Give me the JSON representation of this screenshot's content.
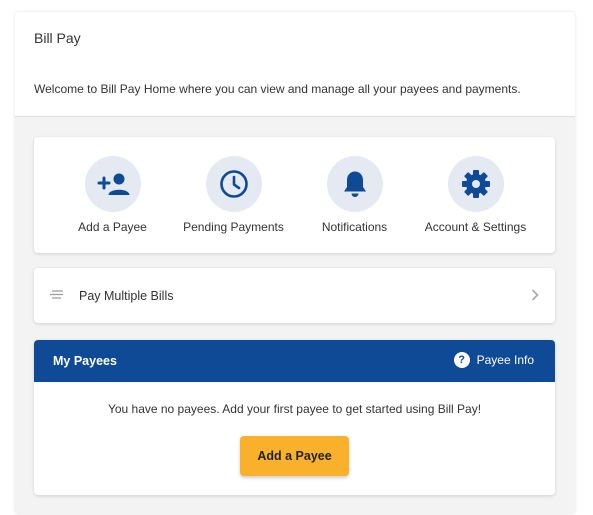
{
  "header": {
    "title": "Bill Pay",
    "welcome": "Welcome to Bill Pay Home where you can view and manage all your payees and payments."
  },
  "quick_actions": [
    {
      "label": "Add a Payee",
      "icon": "add-person-icon"
    },
    {
      "label": "Pending Payments",
      "icon": "clock-icon"
    },
    {
      "label": "Notifications",
      "icon": "bell-icon"
    },
    {
      "label": "Account & Settings",
      "icon": "gear-icon"
    }
  ],
  "pay_multiple": {
    "label": "Pay Multiple Bills",
    "icon": "lines-icon"
  },
  "payees": {
    "title": "My Payees",
    "info_label": "Payee Info",
    "info_icon": "question-icon",
    "empty_message": "You have no payees. Add your first payee to get started using Bill Pay!",
    "add_button": "Add a Payee"
  },
  "colors": {
    "brand_blue": "#0f4a96",
    "icon_circle": "#e4e9f2",
    "button_amber": "#f9b12c"
  }
}
